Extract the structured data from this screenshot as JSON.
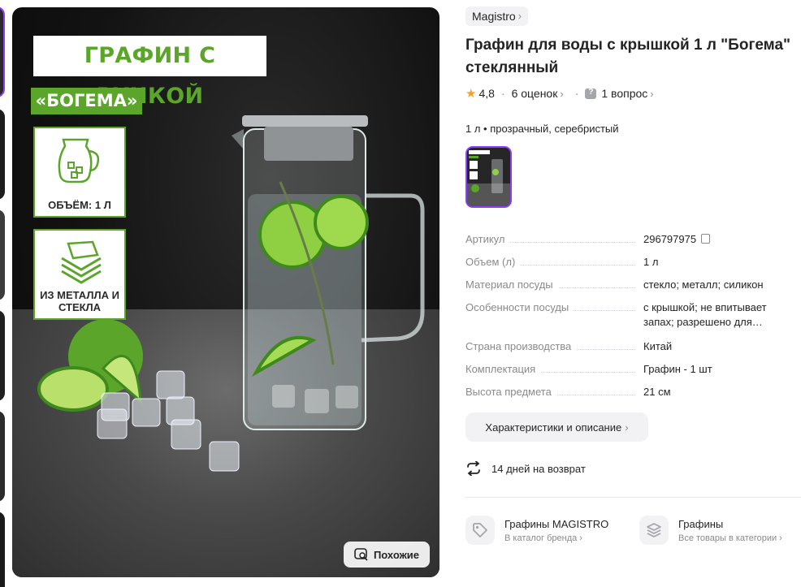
{
  "gallery": {
    "promo_title": "ГРАФИН С РУЧКОЙ",
    "promo_subtitle": "«БОГЕМА»",
    "features": [
      {
        "label": "ОБЪЁМ: 1 Л",
        "icon": "jug-icon"
      },
      {
        "label": "ИЗ МЕТАЛЛА И СТЕКЛА",
        "icon": "layers-icon"
      }
    ],
    "similar_button": "Похожие",
    "accent_color": "#5aa52a",
    "selected_color": "#8b3ffd"
  },
  "product": {
    "brand": "Magistro",
    "title": "Графин для воды с крышкой 1 л \"Богема\" стеклянный",
    "rating": "4,8",
    "reviews": "6 оценок",
    "questions": "1 вопрос",
    "variant": "1 л • прозрачный, серебристый"
  },
  "specs": [
    {
      "key": "Артикул",
      "value": "296797975"
    },
    {
      "key": "Объем (л)",
      "value": "1 л"
    },
    {
      "key": "Материал посуды",
      "value": "стекло; металл; силикон"
    },
    {
      "key": "Особенности посуды",
      "value": "с крышкой; не впитывает запах; разрешено для…"
    },
    {
      "key": "Страна производства",
      "value": "Китай"
    },
    {
      "key": "Комплектация",
      "value": "Графин - 1 шт"
    },
    {
      "key": "Высота предмета",
      "value": "21 см"
    }
  ],
  "characteristics_button": "Характеристики и описание",
  "return_policy": "14 дней на возврат",
  "links": [
    {
      "title": "Графины MAGISTRO",
      "subtitle": "В каталог бренда",
      "icon": "tag-icon"
    },
    {
      "title": "Графины",
      "subtitle": "Все товары в категории",
      "icon": "stack-icon"
    }
  ]
}
